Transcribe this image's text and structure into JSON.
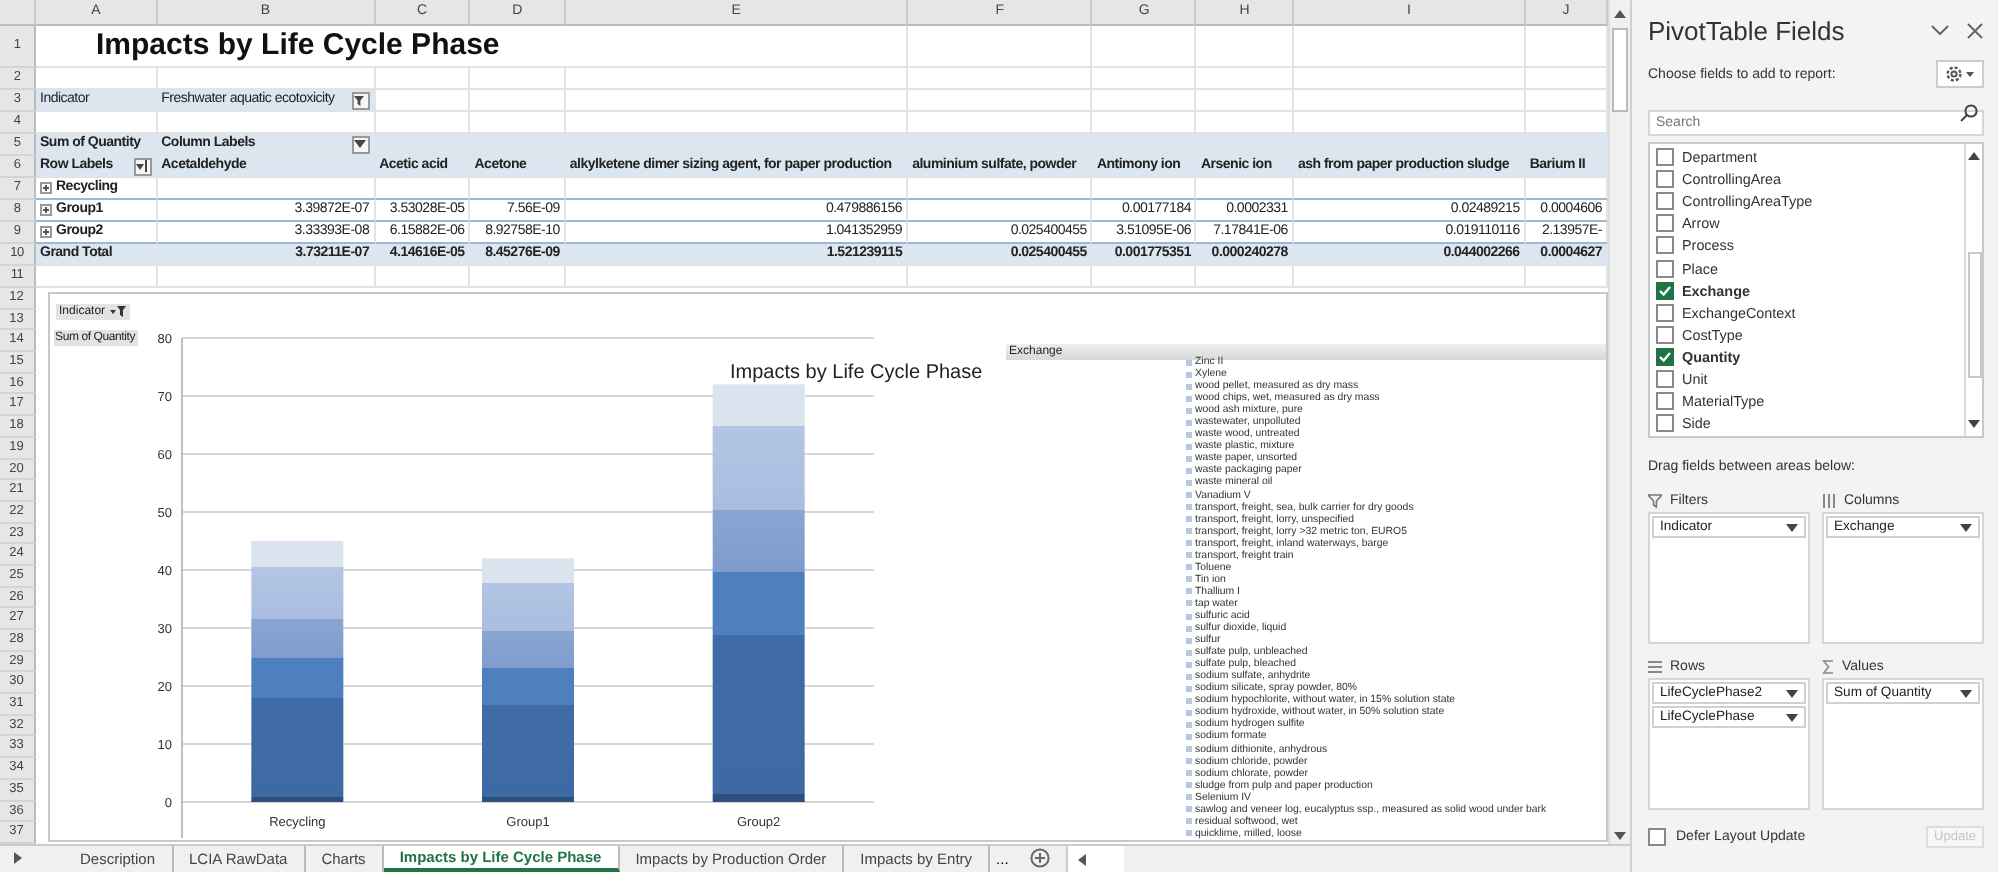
{
  "sheet": {
    "column_letters": [
      "A",
      "B",
      "C",
      "D",
      "E",
      "F",
      "G",
      "H",
      "I",
      "J"
    ],
    "row_numbers": [
      "1",
      "2",
      "3",
      "4",
      "5",
      "6",
      "7",
      "8",
      "9",
      "10",
      "11",
      "12",
      "13",
      "14",
      "15",
      "16",
      "17",
      "18",
      "19",
      "20",
      "21",
      "22",
      "23",
      "24",
      "25",
      "26",
      "27",
      "28",
      "29",
      "30",
      "31",
      "32",
      "33",
      "34",
      "35",
      "36",
      "37"
    ]
  },
  "title": "Impacts by Life Cycle Phase",
  "report_filter": {
    "label": "Indicator",
    "value": "Freshwater aquatic ecotoxicity"
  },
  "pivot_table": {
    "values_label": "Sum of Quantity",
    "column_labels": "Column Labels",
    "row_labels": "Row Labels",
    "headers": [
      "Acetaldehyde",
      "Acetic acid",
      "Acetone",
      "alkylketene dimer sizing agent, for paper production",
      "aluminium sulfate, powder",
      "Antimony ion",
      "Arsenic ion",
      "ash from paper production sludge",
      "Barium II"
    ],
    "rows": [
      {
        "label": "Recycling",
        "cells": []
      },
      {
        "label": "Group1",
        "cells": [
          "3.39872E-07",
          "3.53028E-05",
          "7.56E-09",
          "0.479886156",
          "",
          "0.00177184",
          "0.0002331",
          "0.02489215",
          "0.0004606"
        ]
      },
      {
        "label": "Group2",
        "cells": [
          "3.33393E-08",
          "6.15882E-06",
          "8.92758E-10",
          "1.041352959",
          "0.025400455",
          "3.51095E-06",
          "7.17841E-06",
          "0.019110116",
          "2.13957E-"
        ]
      }
    ],
    "grand_total": {
      "label": "Grand Total",
      "cells": [
        "3.73211E-07",
        "4.14616E-05",
        "8.45276E-09",
        "1.521239115",
        "0.025400455",
        "0.001775351",
        "0.000240278",
        "0.044002266",
        "0.0004627"
      ]
    }
  },
  "chart": {
    "filter_button": "Indicator",
    "legend_button": "Exchange",
    "chart_data": {
      "type": "bar",
      "stacked": true,
      "grid": true,
      "title": "Impacts by Life Cycle Phase",
      "categories": [
        "Recycling",
        "Group1",
        "Group2"
      ],
      "series": [
        {
          "name": "Sum of Quantity",
          "values": [
            45,
            42,
            72
          ]
        }
      ],
      "ylim": [
        0,
        80
      ],
      "yticks": [
        0,
        10,
        20,
        30,
        40,
        50,
        60,
        70,
        80
      ]
    },
    "legend": [
      "Zinc II",
      "Xylene",
      "wood pellet, measured as dry mass",
      "wood chips, wet, measured as dry mass",
      "wood ash mixture, pure",
      "wastewater, unpolluted",
      "waste wood, untreated",
      "waste plastic, mixture",
      "waste paper, unsorted",
      "waste packaging paper",
      "waste mineral oil",
      "Vanadium V",
      "transport, freight, sea, bulk carrier for dry goods",
      "transport, freight, lorry, unspecified",
      "transport, freight, lorry >32 metric ton, EURO5",
      "transport, freight, inland waterways, barge",
      "transport, freight train",
      "Toluene",
      "Tin ion",
      "Thallium I",
      "tap water",
      "sulfuric acid",
      "sulfur dioxide, liquid",
      "sulfur",
      "sulfate pulp, unbleached",
      "sulfate pulp, bleached",
      "sodium sulfate, anhydrite",
      "sodium silicate, spray powder, 80%",
      "sodium hypochlorite, without water, in 15% solution state",
      "sodium hydroxide, without water, in 50% solution state",
      "sodium hydrogen sulfite",
      "sodium formate",
      "sodium dithionite, anhydrous",
      "sodium chloride, powder",
      "sodium chlorate, powder",
      "sludge from pulp and paper production",
      "Selenium IV",
      "sawlog and veneer log, eucalyptus ssp., measured as solid wood under bark",
      "residual softwood, wet",
      "quicklime, milled, loose"
    ]
  },
  "sheet_tabs": [
    {
      "label": "Description",
      "selected": false
    },
    {
      "label": "LCIA RawData",
      "selected": false
    },
    {
      "label": "Charts",
      "selected": false
    },
    {
      "label": "Impacts by Life Cycle Phase",
      "selected": true
    },
    {
      "label": "Impacts by Production Order",
      "selected": false
    },
    {
      "label": "Impacts by Entry",
      "selected": false
    }
  ],
  "more_tabs": "...",
  "pivot_pane": {
    "title": "PivotTable Fields",
    "subtitle": "Choose fields to add to report:",
    "search_placeholder": "Search",
    "fields": [
      {
        "label": "Department",
        "checked": false
      },
      {
        "label": "ControllingArea",
        "checked": false
      },
      {
        "label": "ControllingAreaType",
        "checked": false
      },
      {
        "label": "Arrow",
        "checked": false
      },
      {
        "label": "Process",
        "checked": false
      },
      {
        "label": "Place",
        "checked": false
      },
      {
        "label": "Exchange",
        "checked": true
      },
      {
        "label": "ExchangeContext",
        "checked": false
      },
      {
        "label": "CostType",
        "checked": false
      },
      {
        "label": "Quantity",
        "checked": true
      },
      {
        "label": "Unit",
        "checked": false
      },
      {
        "label": "MaterialType",
        "checked": false
      },
      {
        "label": "Side",
        "checked": false
      }
    ],
    "drag_hint": "Drag fields between areas below:",
    "areas": [
      {
        "kind": "filters",
        "label": "Filters",
        "items": [
          "Indicator"
        ]
      },
      {
        "kind": "columns",
        "label": "Columns",
        "items": [
          "Exchange"
        ]
      },
      {
        "kind": "rows",
        "label": "Rows",
        "items": [
          "LifeCyclePhase2",
          "LifeCyclePhase"
        ]
      },
      {
        "kind": "values",
        "label": "Values",
        "items": [
          "Sum of Quantity"
        ]
      }
    ],
    "defer": {
      "label": "Defer Layout Update",
      "checked": false
    },
    "update_button": {
      "label": "Update",
      "disabled": true
    }
  }
}
